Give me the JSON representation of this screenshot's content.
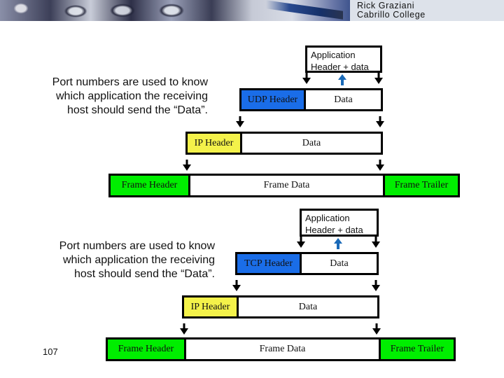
{
  "banner": {
    "author": "Rick Graziani",
    "institution": "Cabrillo College"
  },
  "diagrams": [
    {
      "note": [
        "Port numbers are used to know",
        "which application the receiving",
        "host should send the “Data”."
      ],
      "application_box": [
        "Application",
        "Header + data"
      ],
      "transport": {
        "header": "UDP Header",
        "data": "Data",
        "header_color": "#1a6de8"
      },
      "network": {
        "header": "IP Header",
        "data": "Data",
        "header_color": "#f4f24a"
      },
      "frame": {
        "header": "Frame Header",
        "data": "Frame Data",
        "trailer": "Frame Trailer",
        "color": "#00ee00"
      }
    },
    {
      "note": [
        "Port numbers are used to know",
        "which application the receiving",
        "host should send the “Data”."
      ],
      "application_box": [
        "Application",
        "Header + data"
      ],
      "transport": {
        "header": "TCP Header",
        "data": "Data",
        "header_color": "#1a6de8"
      },
      "network": {
        "header": "IP Header",
        "data": "Data",
        "header_color": "#f4f24a"
      },
      "frame": {
        "header": "Frame Header",
        "data": "Frame Data",
        "trailer": "Frame Trailer",
        "color": "#00ee00"
      }
    }
  ],
  "icons": {
    "down_arrow": "down-arrow-icon",
    "up_arrow": "up-arrow-icon"
  },
  "page_number": "107"
}
